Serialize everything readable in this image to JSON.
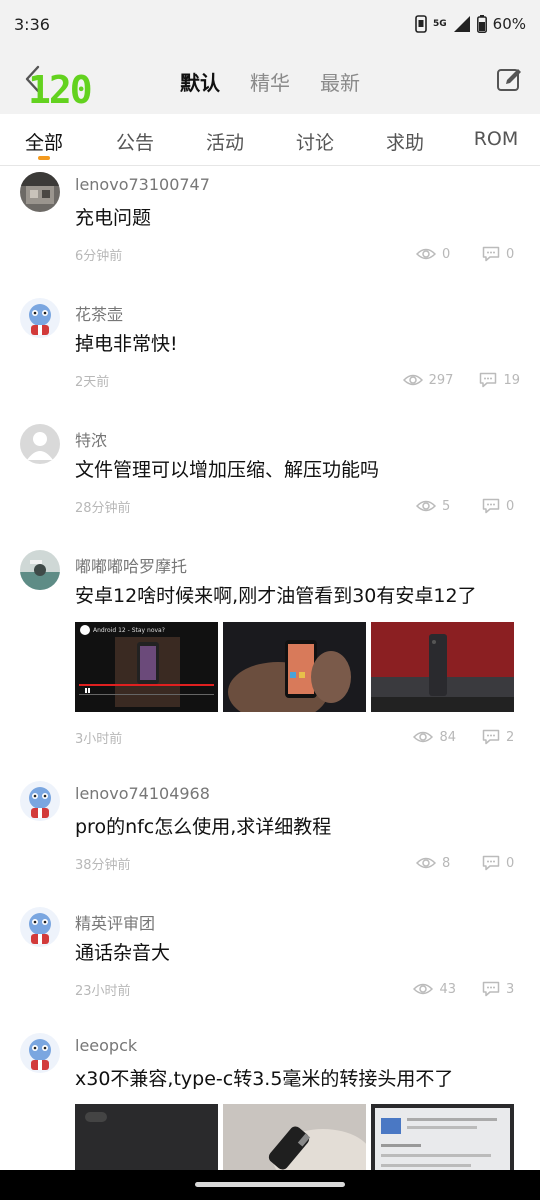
{
  "status": {
    "time": "3:36",
    "network": "5G",
    "battery": "60%"
  },
  "header": {
    "badge": "120",
    "tabs": [
      "默认",
      "精华",
      "最新"
    ],
    "active_tab": 0
  },
  "categories": [
    "全部",
    "公告",
    "活动",
    "讨论",
    "求助",
    "ROM"
  ],
  "active_category": 0,
  "posts": [
    {
      "author": "lenovo73100747",
      "title": "充电问题",
      "time": "6分钟前",
      "views": "0",
      "comments": "0",
      "avatar": "photo"
    },
    {
      "author": "花茶壶",
      "title": "掉电非常快!",
      "time": "2天前",
      "views": "297",
      "comments": "19",
      "avatar": "cartoon"
    },
    {
      "author": "特浓",
      "title": "文件管理可以增加压缩、解压功能吗",
      "time": "28分钟前",
      "views": "5",
      "comments": "0",
      "avatar": "default"
    },
    {
      "author": "嘟嘟嘟哈罗摩托",
      "title": "安卓12啥时候来啊,刚才油管看到30有安卓12了",
      "time": "3小时前",
      "views": "84",
      "comments": "2",
      "avatar": "photo2",
      "video_caption": "Android 12 - Stay nova?"
    },
    {
      "author": "lenovo74104968",
      "title": "pro的nfc怎么使用,求详细教程",
      "time": "38分钟前",
      "views": "8",
      "comments": "0",
      "avatar": "cartoon"
    },
    {
      "author": "精英评审团",
      "title": "通话杂音大",
      "time": "23小时前",
      "views": "43",
      "comments": "3",
      "avatar": "cartoon"
    },
    {
      "author": "leeopck",
      "title": "x30不兼容,type-c转3.5毫米的转接头用不了",
      "time": "",
      "views": "",
      "comments": "",
      "avatar": "cartoon"
    }
  ],
  "colors": {
    "accent": "#f39a1f",
    "badge": "#63d21f"
  }
}
